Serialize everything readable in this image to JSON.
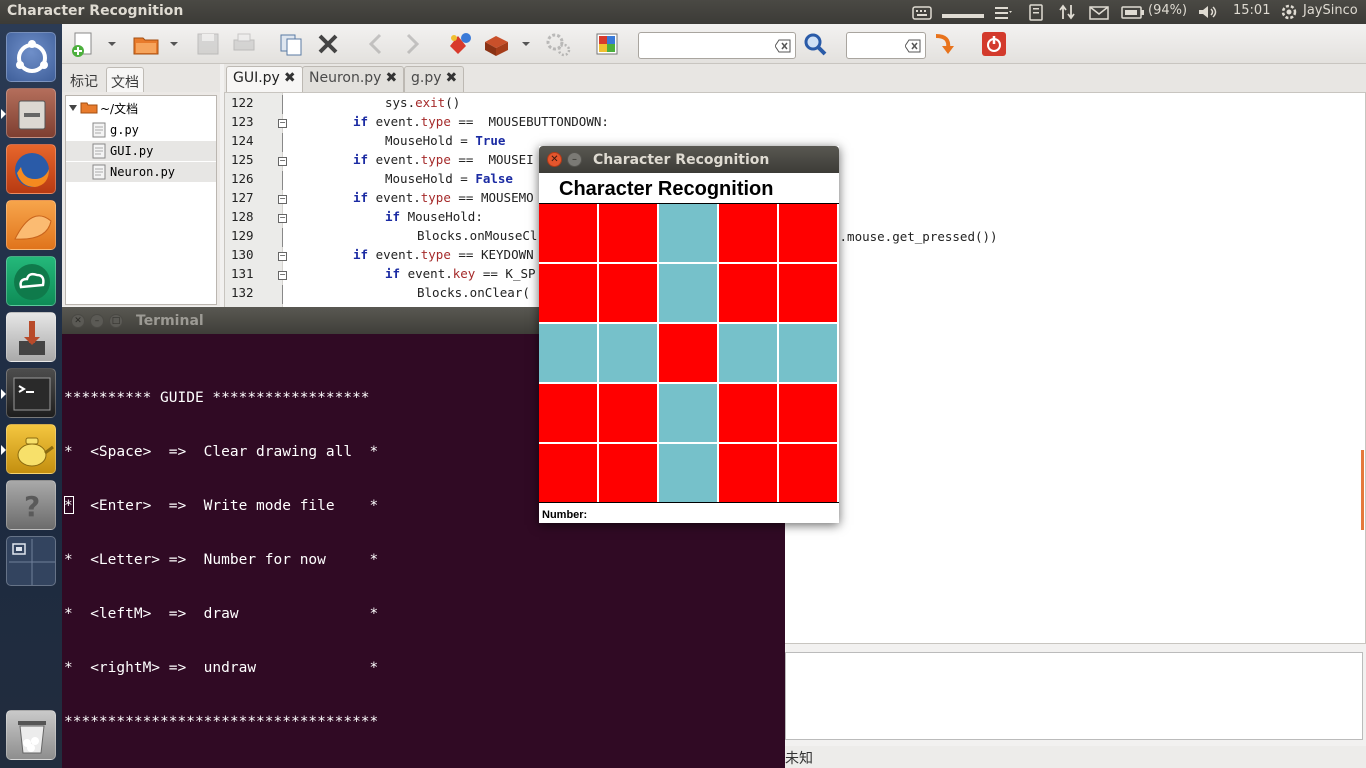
{
  "top_panel": {
    "app_title": "Character Recognition",
    "battery": "(94%)",
    "clock": "15:01",
    "user": "JaySinco",
    "icons": [
      "keyboard-icon",
      "menu-icon",
      "network-icon",
      "updown-icon",
      "mail-icon",
      "battery-icon",
      "volume-icon",
      "power-gear-icon"
    ]
  },
  "launcher": {
    "items": [
      {
        "name": "ubuntu-dash-icon",
        "color": "#3f5f9a"
      },
      {
        "name": "files-icon",
        "color": "#8d4d3e"
      },
      {
        "name": "firefox-icon",
        "color": "#d24b1b"
      },
      {
        "name": "orange-app-icon",
        "color": "#e98a2a"
      },
      {
        "name": "cloud-sync-icon",
        "color": "#18a26a"
      },
      {
        "name": "installer-icon",
        "color": "#cfcfcf"
      },
      {
        "name": "terminal-icon",
        "color": "#2b2b2b"
      },
      {
        "name": "teapot-app-icon",
        "color": "#d6a21c"
      },
      {
        "name": "help-icon",
        "color": "#8a8a8a"
      },
      {
        "name": "workspace-switcher-icon",
        "color": "#3d4f6e"
      },
      {
        "name": "trash-icon",
        "color": "#9a9a9a"
      }
    ]
  },
  "gedit": {
    "side_tabs": [
      "标记",
      "文档"
    ],
    "tree_root": "~/文档",
    "files": [
      "g.py",
      "GUI.py",
      "Neuron.py"
    ],
    "doc_tabs": [
      "GUI.py",
      "Neuron.py",
      "g.py"
    ],
    "status_text": "未知",
    "lines": [
      {
        "n": "122",
        "code": "sys.exit()"
      },
      {
        "n": "123",
        "code": "if event.type ==  MOUSEBUTTONDOWN:"
      },
      {
        "n": "124",
        "code": "MouseHold = True"
      },
      {
        "n": "125",
        "code": "if event.type ==  MOUSEI"
      },
      {
        "n": "126",
        "code": "MouseHold = False"
      },
      {
        "n": "127",
        "code": "if event.type == MOUSEMO"
      },
      {
        "n": "128",
        "code": "if MouseHold:"
      },
      {
        "n": "129",
        "code": "Blocks.onMouseCl"
      },
      {
        "n": "130",
        "code": "if event.type == KEYDOWN"
      },
      {
        "n": "131",
        "code": "if event.key == K_SP"
      },
      {
        "n": "132",
        "code": "Blocks.onClear("
      }
    ],
    "line_129_tail": "e.mouse.get_pressed())"
  },
  "terminal": {
    "title": "Terminal",
    "lines": [
      "********** GUIDE ******************",
      "*  <Space>  =>  Clear drawing all  *",
      "*  <Enter>  =>  Write mode file    *",
      "*  <Letter> =>  Number for now     *",
      "*  <leftM>  =>  draw               *",
      "*  <rightM> =>  undraw             *",
      "************************************"
    ]
  },
  "cr_window": {
    "title": "Character Recognition",
    "heading": "Character Recognition",
    "number_label": "Number:",
    "colors": {
      "on": "#ff0000",
      "off": "#76c1ca"
    },
    "grid": [
      [
        1,
        1,
        0,
        1,
        1
      ],
      [
        1,
        1,
        0,
        1,
        1
      ],
      [
        0,
        0,
        1,
        0,
        0
      ],
      [
        1,
        1,
        0,
        1,
        1
      ],
      [
        1,
        1,
        0,
        1,
        1
      ]
    ]
  }
}
